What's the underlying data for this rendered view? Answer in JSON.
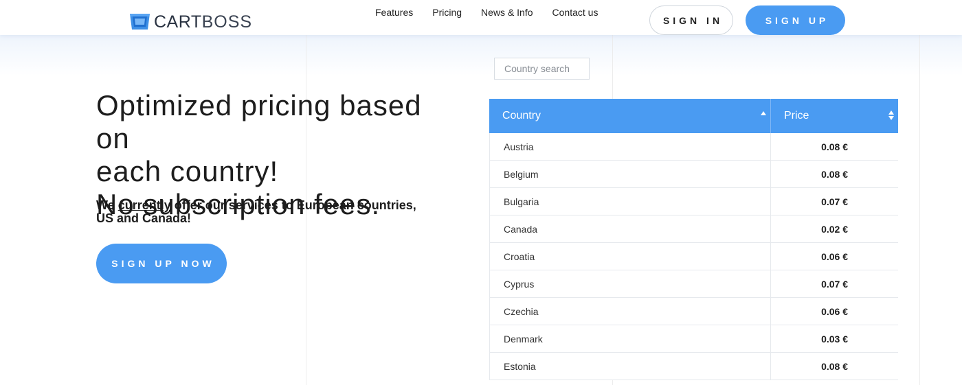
{
  "header": {
    "logo_text_bold": "CART",
    "logo_text_light": "BOSS",
    "nav": [
      "Features",
      "Pricing",
      "News & Info",
      "Contact us"
    ],
    "sign_in": "SIGN IN",
    "sign_up": "SIGN UP"
  },
  "hero": {
    "title_lines": [
      "Optimized pricing based on",
      "each country!",
      "No subscription fees."
    ],
    "sub_before": "We ",
    "sub_link": "currently",
    "sub_after": " offer our services to European countries, US and Canada!",
    "cta": "SIGN UP NOW"
  },
  "search": {
    "placeholder": "Country search",
    "value": ""
  },
  "table": {
    "headers": {
      "country": "Country",
      "price": "Price"
    },
    "rows": [
      {
        "country": "Austria",
        "price": "0.08 €"
      },
      {
        "country": "Belgium",
        "price": "0.08 €"
      },
      {
        "country": "Bulgaria",
        "price": "0.07 €"
      },
      {
        "country": "Canada",
        "price": "0.02 €"
      },
      {
        "country": "Croatia",
        "price": "0.06 €"
      },
      {
        "country": "Cyprus",
        "price": "0.07 €"
      },
      {
        "country": "Czechia",
        "price": "0.06 €"
      },
      {
        "country": "Denmark",
        "price": "0.03 €"
      },
      {
        "country": "Estonia",
        "price": "0.08 €"
      }
    ]
  },
  "colors": {
    "accent": "#4a9bf2",
    "text": "#1d1d1d",
    "border": "#e6e9ed"
  }
}
